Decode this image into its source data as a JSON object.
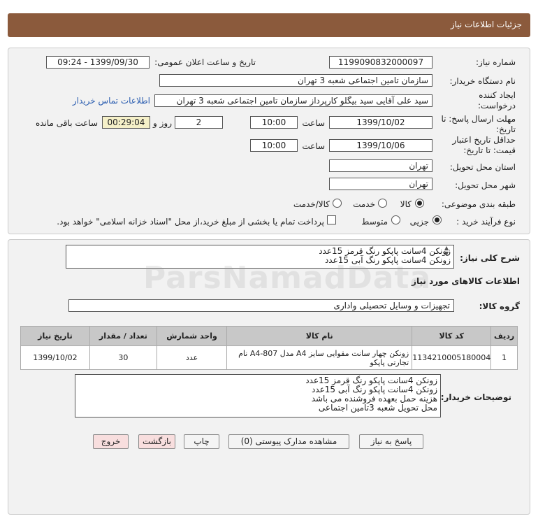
{
  "header": {
    "title": "جزئیات اطلاعات نیاز"
  },
  "fields": {
    "need_number_label": "شماره نیاز:",
    "need_number": "1199090832000097",
    "announce_label": "تاریخ و ساعت اعلان عمومی:",
    "announce_value": "1399/09/30 - 09:24",
    "buyer_org_label": "نام دستگاه خریدار:",
    "buyer_org": "سازمان تامین اجتماعی شعبه 3 تهران",
    "creator_label": "ایجاد کننده درخواست:",
    "creator": "سید علی آقایی سید بیگلو کارپرداز سازمان تامین اجتماعی شعبه 3 تهران",
    "contact_link": "اطلاعات تماس خریدار",
    "deadline_label": "مهلت ارسال پاسخ: تا تاریخ:",
    "deadline_date": "1399/10/02",
    "time_label": "ساعت",
    "deadline_time": "10:00",
    "day_label": "روز و",
    "days": "2",
    "remaining": "00:29:04",
    "remaining_label": "ساعت باقی مانده",
    "validity_label": "حداقل تاریخ اعتبار قیمت: تا تاریخ:",
    "validity_date": "1399/10/06",
    "validity_time": "10:00",
    "province_label": "استان محل تحویل:",
    "province": "تهران",
    "city_label": "شهر محل تحویل:",
    "city": "تهران",
    "category_label": "طبقه بندی موضوعی:",
    "cat_goods": "کالا",
    "cat_service": "خدمت",
    "cat_both": "کالا/خدمت",
    "process_label": "نوع فرآیند خرید :",
    "proc_partial": "جزیی",
    "proc_medium": "متوسط",
    "proc_note": "پرداخت تمام یا بخشی از مبلغ خرید،از محل \"اسناد خزانه اسلامی\" خواهد بود."
  },
  "summary": {
    "label": "شرح کلی نیاز:",
    "line1": "زونکن 4سانت پاپکو  رنگ قرمز 15عدد",
    "line2": "زونکن 4سانت پاپکو رنگ آبی 15عدد"
  },
  "goods": {
    "section_title": "اطلاعات کالاهای مورد نیاز",
    "group_label": "گروه کالا:",
    "group_value": "تجهیزات و وسایل تحصیلی واداری",
    "columns": [
      "ردیف",
      "کد کالا",
      "نام کالا",
      "واحد شمارش",
      "تعداد / مقدار",
      "تاریخ نیاز"
    ],
    "rows": [
      {
        "idx": "1",
        "code": "1134210005180004",
        "name": "زونکن چهار سانت مقوایی سایز A4 مدل A4-807 نام تجارتی پاپکو",
        "unit": "عدد",
        "qty": "30",
        "date": "1399/10/02"
      }
    ]
  },
  "buyer_notes": {
    "label": "توضیحات خریدار:",
    "lines": [
      "زونکن 4سانت پاپکو  رنگ قرمز 15عدد",
      "زونکن 4سانت پاپکو رنگ آبی 15عدد",
      "هزینه حمل بعهده فروشنده می باشد",
      "محل تحویل شعبه 3تامین اجتماعی"
    ]
  },
  "buttons": {
    "reply": "پاسخ به نیاز",
    "attachments": "مشاهده مدارک پیوستی (0)",
    "print": "چاپ",
    "back": "بازگشت",
    "exit": "خروج"
  },
  "watermark": {
    "brand": "ParsNamadData"
  },
  "colors": {
    "header": "#8b5a3c",
    "panel": "#f2f2f2",
    "link": "#2a5db0"
  }
}
